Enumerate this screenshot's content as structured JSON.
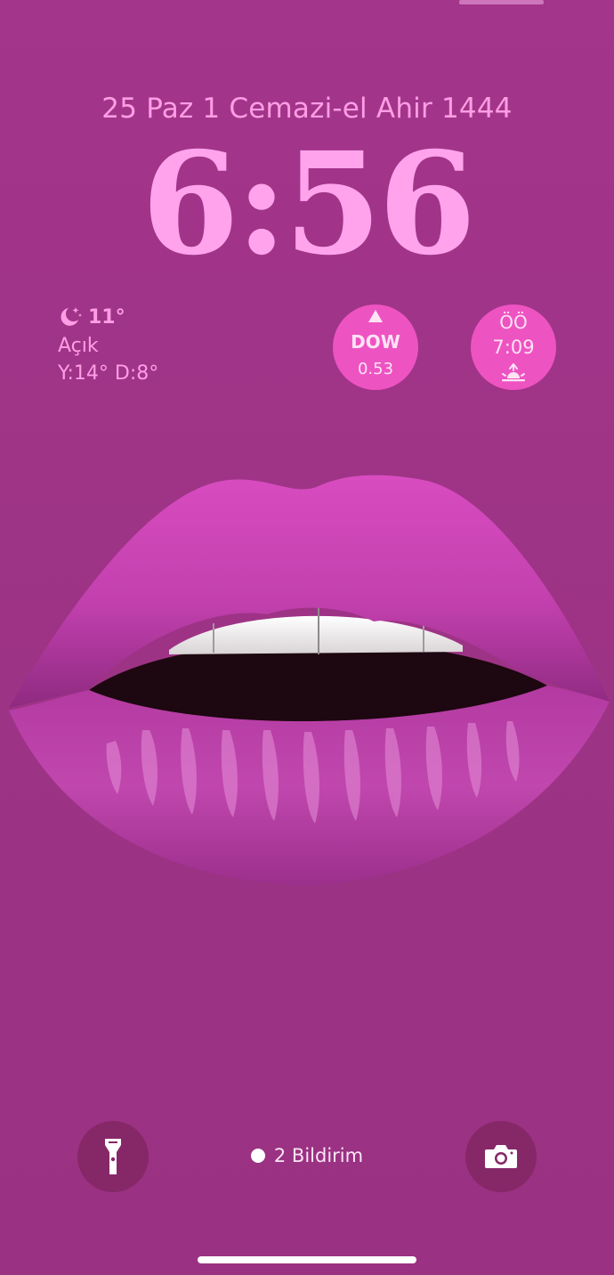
{
  "lock_screen": {
    "date_line": "25 Paz  1 Cemazi-el Ahir 1444",
    "time": "6:56"
  },
  "weather_widget": {
    "icon": "moon-stars-icon",
    "temperature": "11°",
    "condition": "Açık",
    "high_low": "Y:14° D:8°"
  },
  "stock_widget": {
    "icon": "triangle-up-icon",
    "symbol": "DOW",
    "change": "0.53"
  },
  "sun_widget": {
    "label": "ÖÖ",
    "time": "7:09",
    "icon": "sunrise-icon"
  },
  "bottom_bar": {
    "flashlight_icon": "flashlight-icon",
    "notifications": "2 Bildirim",
    "camera_icon": "camera-icon"
  },
  "colors": {
    "background": "#a03485",
    "clock": "#ffa3ec",
    "widget": "#ee53c2",
    "button": "#862868"
  }
}
